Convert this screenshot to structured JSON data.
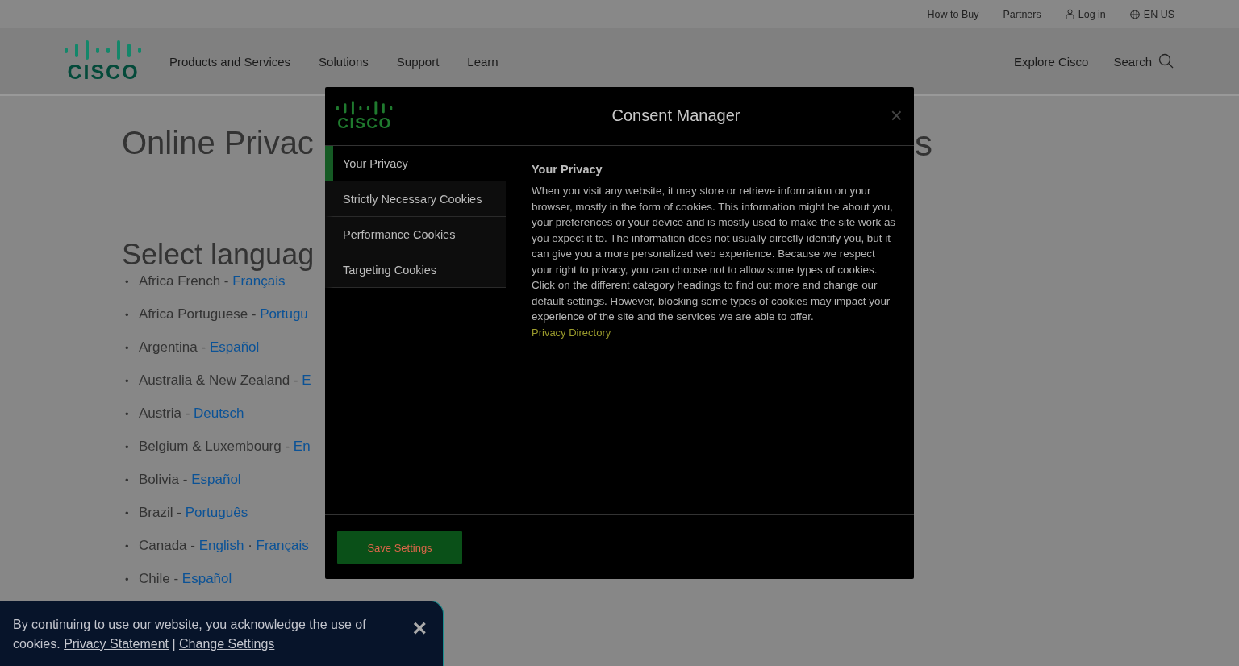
{
  "utility_bar": {
    "links": [
      "How to Buy",
      "Partners",
      "Log in",
      "EN US"
    ]
  },
  "header": {
    "logo_text": "CISCO",
    "nav": [
      "Products and Services",
      "Solutions",
      "Support",
      "Learn"
    ],
    "explore": "Explore Cisco",
    "search": "Search"
  },
  "page": {
    "title_visible": "Online Privac",
    "title_tail": "s",
    "subtitle": "Select languag",
    "list_marker": "•",
    "languages": [
      {
        "country": "Africa French -",
        "links": [
          "Français"
        ]
      },
      {
        "country": "Africa Portuguese -",
        "links": [
          "Portugu"
        ]
      },
      {
        "country": "Argentina -",
        "links": [
          "Español"
        ]
      },
      {
        "country": "Australia & New Zealand -",
        "links": [
          "E"
        ]
      },
      {
        "country": "Austria -",
        "links": [
          "Deutsch"
        ]
      },
      {
        "country": "Belgium & Luxembourg -",
        "links": [
          "En"
        ]
      },
      {
        "country": "Bolivia -",
        "links": [
          "Español"
        ]
      },
      {
        "country": "Brazil -",
        "links": [
          "Português"
        ]
      },
      {
        "country": "Canada -",
        "links": [
          "English",
          "Français"
        ],
        "separator": "·"
      },
      {
        "country": "Chile -",
        "links": [
          "Español"
        ]
      }
    ]
  },
  "consent_modal": {
    "logo_text": "CISCO",
    "title": "Consent Manager",
    "close": "×",
    "menu": [
      {
        "label": "Your Privacy",
        "selected": true
      },
      {
        "label": "Strictly Necessary Cookies",
        "selected": false
      },
      {
        "label": "Performance Cookies",
        "selected": false
      },
      {
        "label": "Targeting Cookies",
        "selected": false
      }
    ],
    "heading": "Your Privacy",
    "body": "When you visit any website, it may store or retrieve information on your browser, mostly in the form of cookies. This information might be about you, your preferences or your device and is mostly used to make the site work as you expect it to. The information does not usually directly identify you, but it can give you a more personalized web experience. Because we respect your right to privacy, you can choose not to allow some types of cookies. Click on the different category headings to find out more and change our default settings. However, blocking some types of cookies may impact your experience of the site and the services we are able to offer.",
    "link": "Privacy Directory",
    "save_button": "Save Settings"
  },
  "cookie_banner": {
    "text": "By continuing to use our website, you acknowledge the use of cookies.",
    "links": [
      "Privacy Statement",
      "Change Settings"
    ],
    "separator": "|",
    "close": "×"
  }
}
